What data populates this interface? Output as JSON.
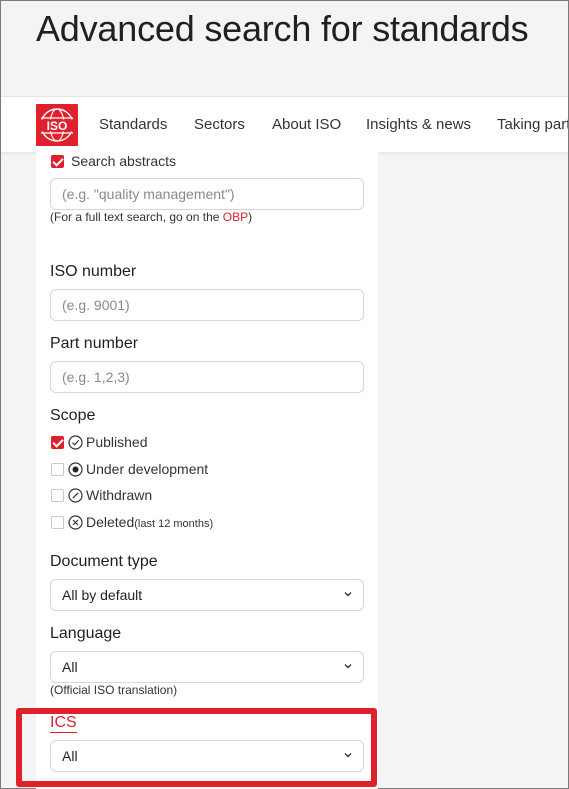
{
  "page": {
    "title": "Advanced search for standards"
  },
  "nav": {
    "items": [
      "Standards",
      "Sectors",
      "About ISO",
      "Insights & news",
      "Taking part"
    ]
  },
  "logo": {
    "text": "ISO"
  },
  "form": {
    "search_abstracts": {
      "label": "Search abstracts",
      "checked": true
    },
    "keyword_placeholder": "(e.g. \"quality management\")",
    "fulltext_note_prefix": "(For a full text search, go on the ",
    "fulltext_note_link": "OBP",
    "fulltext_note_suffix": ")",
    "iso_number": {
      "label": "ISO number",
      "placeholder": "(e.g. 9001)"
    },
    "part_number": {
      "label": "Part number",
      "placeholder": "(e.g. 1,2,3)"
    },
    "scope": {
      "label": "Scope",
      "options": [
        {
          "label": "Published",
          "checked": true,
          "icon": "check-circle-icon"
        },
        {
          "label": "Under development",
          "checked": false,
          "icon": "dot-circle-icon"
        },
        {
          "label": "Withdrawn",
          "checked": false,
          "icon": "slash-circle-icon"
        },
        {
          "label": "Deleted",
          "checked": false,
          "icon": "x-circle-icon",
          "suffix": "(last 12 months)"
        }
      ]
    },
    "document_type": {
      "label": "Document type",
      "value": "All by default"
    },
    "language": {
      "label": "Language",
      "value": "All",
      "note": "(Official ISO translation)"
    },
    "ics": {
      "label": "ICS",
      "value": "All"
    }
  },
  "colors": {
    "accent": "#e0202d",
    "background": "#f4f4f5"
  }
}
